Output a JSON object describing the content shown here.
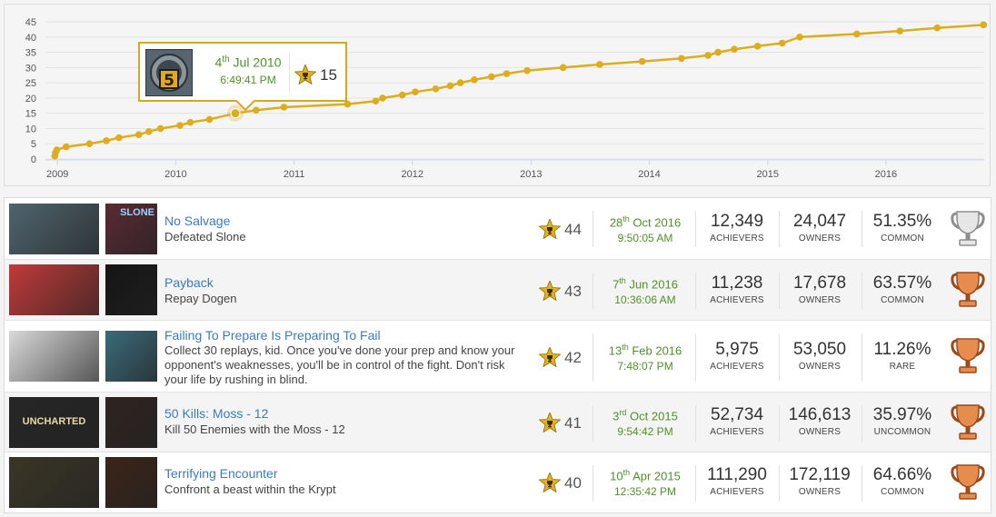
{
  "chart_data": {
    "type": "line",
    "title": "",
    "xlabel": "",
    "ylabel": "",
    "xlim": [
      "2008-11-25",
      "2016-10-30"
    ],
    "ylim": [
      0,
      45
    ],
    "y_ticks": [
      0,
      5,
      10,
      15,
      20,
      25,
      30,
      35,
      40,
      45
    ],
    "x_ticks": [
      "2009",
      "2010",
      "2011",
      "2012",
      "2013",
      "2014",
      "2015",
      "2016"
    ],
    "grid": true,
    "color": "#dcae1d",
    "points": [
      [
        "2008-12-24",
        1
      ],
      [
        "2008-12-26",
        2
      ],
      [
        "2008-12-30",
        3
      ],
      [
        "2009-01-28",
        4
      ],
      [
        "2009-04-10",
        5
      ],
      [
        "2009-06-01",
        6
      ],
      [
        "2009-07-10",
        7
      ],
      [
        "2009-09-09",
        8
      ],
      [
        "2009-10-10",
        9
      ],
      [
        "2009-11-15",
        10
      ],
      [
        "2010-01-14",
        11
      ],
      [
        "2010-02-15",
        12
      ],
      [
        "2010-04-15",
        13
      ],
      [
        "2010-07-04",
        15
      ],
      [
        "2010-09-06",
        16
      ],
      [
        "2010-12-01",
        17
      ],
      [
        "2011-06-15",
        18
      ],
      [
        "2011-09-10",
        19
      ],
      [
        "2011-10-01",
        20
      ],
      [
        "2011-12-01",
        21
      ],
      [
        "2012-01-10",
        22
      ],
      [
        "2012-03-13",
        23
      ],
      [
        "2012-04-27",
        24
      ],
      [
        "2012-05-28",
        25
      ],
      [
        "2012-07-10",
        26
      ],
      [
        "2012-09-01",
        27
      ],
      [
        "2012-10-18",
        28
      ],
      [
        "2012-12-20",
        29
      ],
      [
        "2013-04-10",
        30
      ],
      [
        "2013-08-01",
        31
      ],
      [
        "2013-12-10",
        32
      ],
      [
        "2014-04-10",
        33
      ],
      [
        "2014-07-01",
        34
      ],
      [
        "2014-08-01",
        35
      ],
      [
        "2014-09-20",
        36
      ],
      [
        "2014-12-01",
        37
      ],
      [
        "2015-02-15",
        38
      ],
      [
        "2015-04-10",
        40
      ],
      [
        "2015-10-03",
        41
      ],
      [
        "2016-02-13",
        42
      ],
      [
        "2016-06-07",
        43
      ],
      [
        "2016-10-28",
        44
      ]
    ],
    "highlight": {
      "date": "2010-07-04",
      "value": 15
    }
  },
  "tooltip": {
    "day": "4",
    "suffix": "th",
    "month_year": "Jul 2010",
    "time": "6:49:41 PM",
    "count": "15",
    "badge": "5"
  },
  "rows": [
    {
      "title": "No Salvage",
      "description": "Defeated Slone",
      "rank": "44",
      "day": "28",
      "suffix": "th",
      "month_year": "Oct 2016",
      "time": "9:50:05 AM",
      "achievers": "12,349",
      "owners": "24,047",
      "percent": "51.35%",
      "rarity": "COMMON",
      "trophy_color": "silver",
      "game_art": "#4f646e",
      "ach_art": "#5a2a35",
      "art_text": "SLONE"
    },
    {
      "title": "Payback",
      "description": "Repay Dogen",
      "rank": "43",
      "day": "7",
      "suffix": "th",
      "month_year": "Jun 2016",
      "time": "10:36:06 AM",
      "achievers": "11,238",
      "owners": "17,678",
      "percent": "63.57%",
      "rarity": "COMMON",
      "trophy_color": "bronze",
      "game_art": "#c03a3a",
      "ach_art": "#151515",
      "art_text": ""
    },
    {
      "title": "Failing To Prepare Is Preparing To Fail",
      "description": "Collect 30 replays, kid. Once you've done your prep and know your opponent's weaknesses, you'll be in control of the fight. Don't risk your life by rushing in blind.",
      "rank": "42",
      "day": "13",
      "suffix": "th",
      "month_year": "Feb 2016",
      "time": "7:48:07 PM",
      "achievers": "5,975",
      "owners": "53,050",
      "percent": "11.26%",
      "rarity": "RARE",
      "trophy_color": "bronze",
      "game_art": "#d9d9d9",
      "ach_art": "#3b6b7a",
      "art_text": ""
    },
    {
      "title": "50 Kills: Moss - 12",
      "description": "Kill 50 Enemies with the Moss - 12",
      "rank": "41",
      "day": "3",
      "suffix": "rd",
      "month_year": "Oct 2015",
      "time": "9:54:42 PM",
      "achievers": "52,734",
      "owners": "146,613",
      "percent": "35.97%",
      "rarity": "UNCOMMON",
      "trophy_color": "bronze",
      "game_art": "#262626",
      "ach_art": "#2e2420",
      "art_text": "UNCHARTED"
    },
    {
      "title": "Terrifying Encounter",
      "description": "Confront a beast within the Krypt",
      "rank": "40",
      "day": "10",
      "suffix": "th",
      "month_year": "Apr 2015",
      "time": "12:35:42 PM",
      "achievers": "111,290",
      "owners": "172,119",
      "percent": "64.66%",
      "rarity": "COMMON",
      "trophy_color": "bronze",
      "game_art": "#3a3626",
      "ach_art": "#3b2518",
      "art_text": ""
    }
  ],
  "labels": {
    "achievers": "ACHIEVERS",
    "owners": "OWNERS"
  },
  "colors": {
    "gold": "#dcae1d",
    "date_green": "#4f9128",
    "link_blue": "#3c7bbd"
  },
  "icons": {
    "rank": "trophy-star-icon",
    "trophy": "trophy-cup-icon"
  }
}
